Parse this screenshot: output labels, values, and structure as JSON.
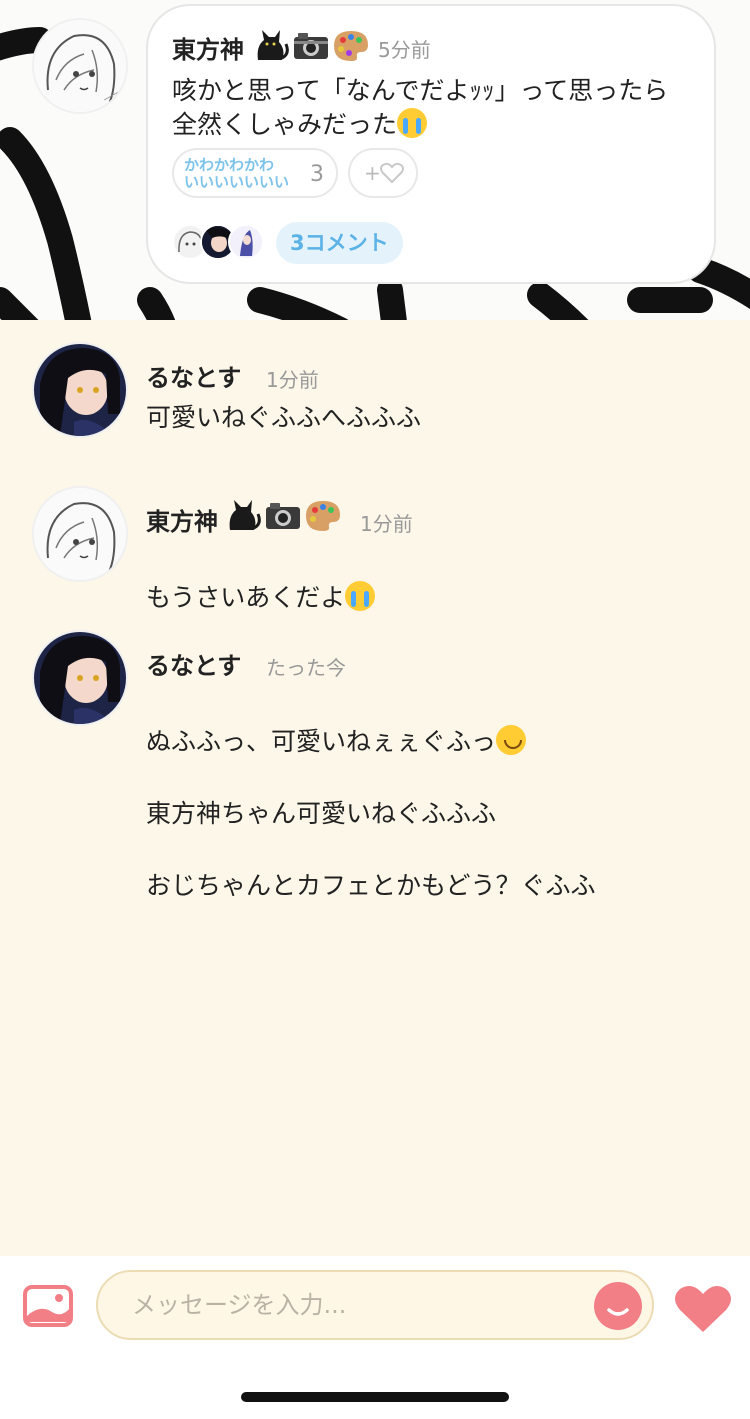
{
  "post": {
    "author": "東方神",
    "author_emojis": [
      "🐈‍⬛",
      "📷",
      "🎨"
    ],
    "time": "5分前",
    "text_line1": "咳かと思って「なんでだよｯｯ」って思ったら",
    "text_line2": "全然くしゃみだった",
    "text_emoji": "loudly-crying-face",
    "reaction_stamp": "かわかわかわ\nいいいいいいい",
    "reaction_count": "3",
    "add_reaction_plus": "+",
    "comment_count_label": "3コメント"
  },
  "comments": [
    {
      "name": "るなとす",
      "time": "1分前",
      "text": "可愛いねぐふふへふふふ",
      "avatar": "dark-hair-girl"
    },
    {
      "name": "東方神",
      "name_emojis": [
        "🐈‍⬛",
        "📷",
        "🎨"
      ],
      "time": "1分前",
      "text": "もうさいあくだよ",
      "text_emoji": "loudly-crying-face",
      "avatar": "sketch-girl"
    },
    {
      "name": "るなとす",
      "time": "たった今",
      "line1": "ぬふふっ、可愛いねぇぇぐふっ",
      "line1_emoji": "slightly-smiling-face",
      "line2": "東方神ちゃん可愛いねぐふふふ",
      "line3": "おじちゃんとカフェとかもどう？ぐふふ",
      "avatar": "dark-hair-girl"
    }
  ],
  "composer": {
    "placeholder": "メッセージを入力..."
  },
  "colors": {
    "background": "#fdf7ea",
    "accent_pink": "#f27e86",
    "link_blue": "#5bb2e6"
  }
}
